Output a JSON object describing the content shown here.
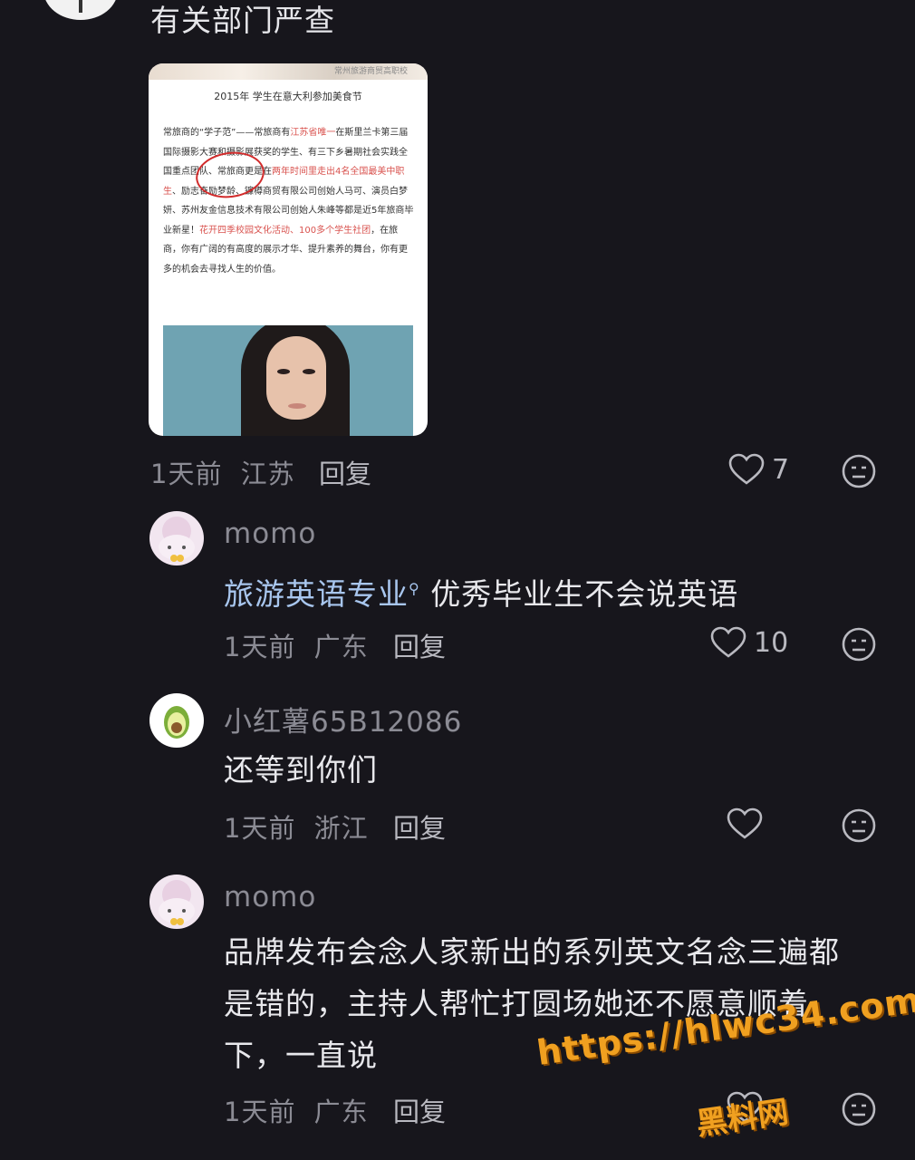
{
  "top_comment": {
    "text": "有关部门严查",
    "image": {
      "watermark": "常州旅游商贸高职校",
      "title": "2015年 学生在意大利参加美食节",
      "para_a": "常旅商的“学子范”——常旅商有",
      "para_red1": "江苏省唯一",
      "para_b": "在斯里兰卡第三届国际摄影大赛和摄影展获奖的学生、有三下乡暑期社会实践全国重点团队、常旅商更是在",
      "para_red2": "两年时间里走出4名全国最美中职生",
      "para_c": "、励志奋励梦龄、镰樽商贸有限公司创始人马可、演员白梦妍、苏州友金信息技术有限公司创始人朱峰等都是近5年旅商毕业新星！",
      "para_red3": "花开四季校园文化活动、100多个学生社团",
      "para_d": "，在旅商，你有广阔的有高度的展示才华、提升素养的舞台，你有更多的机会去寻找人生的价值。"
    },
    "time": "1天前",
    "location": "江苏",
    "reply_label": "回复",
    "likes": "7"
  },
  "comments": [
    {
      "username": "momo",
      "link_text": "旅游英语专业",
      "text": "优秀毕业生不会说英语",
      "time": "1天前",
      "location": "广东",
      "reply_label": "回复",
      "likes": "10"
    },
    {
      "username": "小红薯65B12086",
      "text": "还等到你们",
      "time": "1天前",
      "location": "浙江",
      "reply_label": "回复",
      "likes": ""
    },
    {
      "username": "momo",
      "text_line1": "品牌发布会念人家新出的系列英文名念三遍都",
      "text_line2": "是错的，主持人帮忙打圆场她还不愿意顺着",
      "text_line3": "下，一直说",
      "time": "1天前",
      "location": "广东",
      "reply_label": "回复"
    }
  ],
  "overlay_watermark": {
    "url": "https://hlwc34.com",
    "name": "黑料网"
  },
  "colors": {
    "background": "#17161c",
    "link": "#a8c6ee",
    "watermark": "#f0a020"
  }
}
